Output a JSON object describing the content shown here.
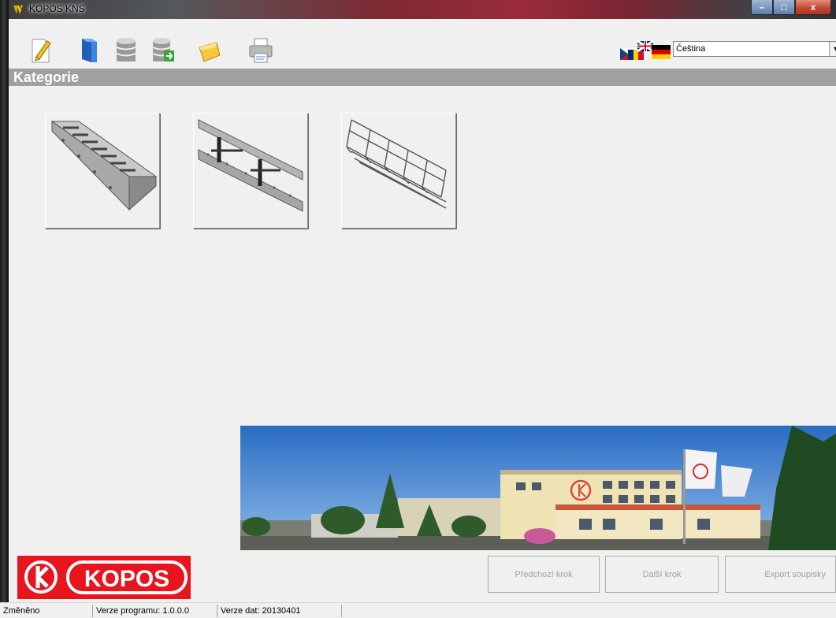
{
  "window": {
    "title": "KOPOS KNS",
    "controls": {
      "minimize": "–",
      "maximize": "□",
      "close": "x"
    }
  },
  "toolbar": {
    "tools": [
      "new-icon",
      "open-icon",
      "database-icon",
      "database-export-icon",
      "tag-icon",
      "print-icon"
    ]
  },
  "language": {
    "selected": "Čeština"
  },
  "header": {
    "title": "Kategorie"
  },
  "categories": [
    {
      "icon": "perforated-cable-tray-icon"
    },
    {
      "icon": "cable-ladder-icon"
    },
    {
      "icon": "wire-mesh-tray-icon"
    }
  ],
  "logo": {
    "text": "KOPOS"
  },
  "buttons": {
    "previous": "Předchozí krok",
    "next": "Další krok",
    "export": "Export soupisky"
  },
  "status": {
    "changed": "Změněno",
    "program_version": "Verze programu: 1.0.0.0",
    "data_version": "Verze dat: 20130401"
  },
  "colors": {
    "brand_red": "#e8141e",
    "header_gray": "#a0a0a0"
  }
}
